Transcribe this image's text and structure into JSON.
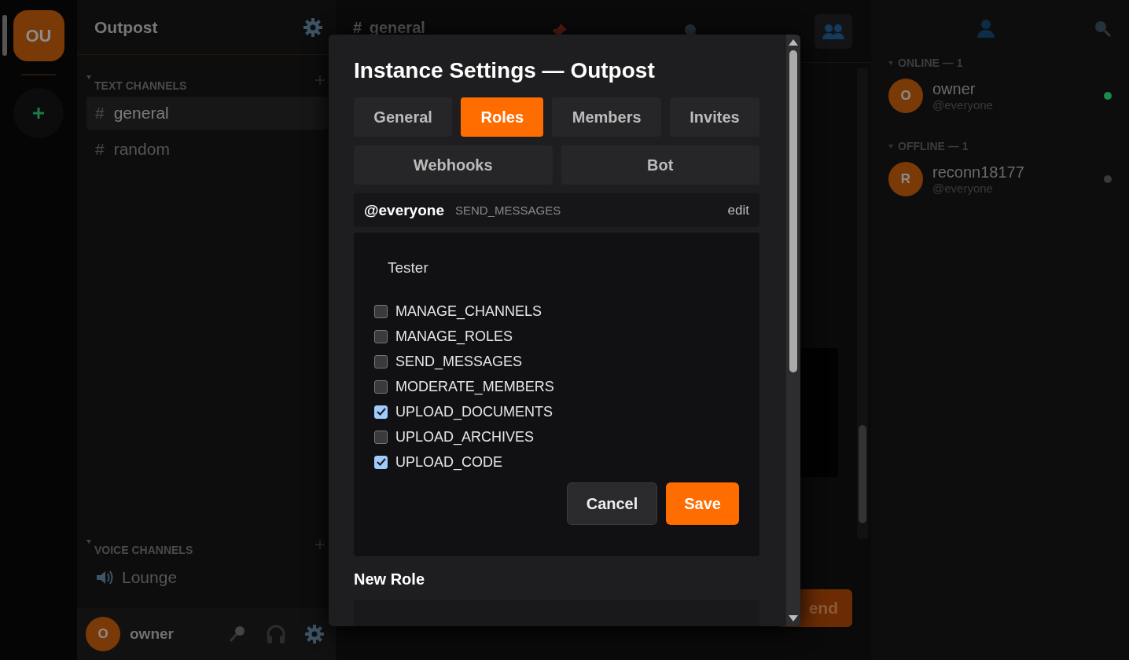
{
  "servers": [
    {
      "label": "OU",
      "selected": true
    }
  ],
  "sidebar": {
    "title": "Outpost",
    "sections": [
      {
        "title": "TEXT CHANNELS",
        "kind": "text",
        "channels": [
          {
            "prefix": "#",
            "name": "general",
            "selected": true
          },
          {
            "prefix": "#",
            "name": "random",
            "selected": false
          }
        ]
      },
      {
        "title": "VOICE CHANNELS",
        "kind": "voice",
        "channels": [
          {
            "name": "Lounge",
            "selected": false
          }
        ]
      }
    ]
  },
  "user_panel": {
    "avatar": "O",
    "name": "owner"
  },
  "channel_header": {
    "prefix": "#",
    "name": "general"
  },
  "composer": {
    "send_label": "end"
  },
  "members": {
    "groups": [
      {
        "title": "ONLINE — 1",
        "members": [
          {
            "avatar": "O",
            "name": "owner",
            "role": "@everyone",
            "online": true
          }
        ]
      },
      {
        "title": "OFFLINE — 1",
        "members": [
          {
            "avatar": "R",
            "name": "reconn18177",
            "role": "@everyone",
            "online": false
          }
        ]
      }
    ]
  },
  "modal": {
    "title": "Instance Settings — Outpost",
    "tabs": [
      {
        "label": "General",
        "selected": false
      },
      {
        "label": "Roles",
        "selected": true
      },
      {
        "label": "Members",
        "selected": false
      },
      {
        "label": "Invites",
        "selected": false
      },
      {
        "label": "Webhooks",
        "selected": false
      },
      {
        "label": "Bot",
        "selected": false
      }
    ],
    "roles": [
      {
        "name": "@everyone",
        "permissions": "SEND_MESSAGES",
        "action": "edit"
      }
    ],
    "editor": {
      "name_value": "Tester",
      "permissions": [
        {
          "label": "MANAGE_CHANNELS",
          "checked": false
        },
        {
          "label": "MANAGE_ROLES",
          "checked": false
        },
        {
          "label": "SEND_MESSAGES",
          "checked": false
        },
        {
          "label": "MODERATE_MEMBERS",
          "checked": false
        },
        {
          "label": "UPLOAD_DOCUMENTS",
          "checked": true
        },
        {
          "label": "UPLOAD_ARCHIVES",
          "checked": false
        },
        {
          "label": "UPLOAD_CODE",
          "checked": true
        }
      ],
      "buttons": [
        {
          "label": "Cancel",
          "primary": false
        },
        {
          "label": "Save",
          "primary": true
        }
      ]
    },
    "new_role": {
      "title": "New Role"
    }
  }
}
